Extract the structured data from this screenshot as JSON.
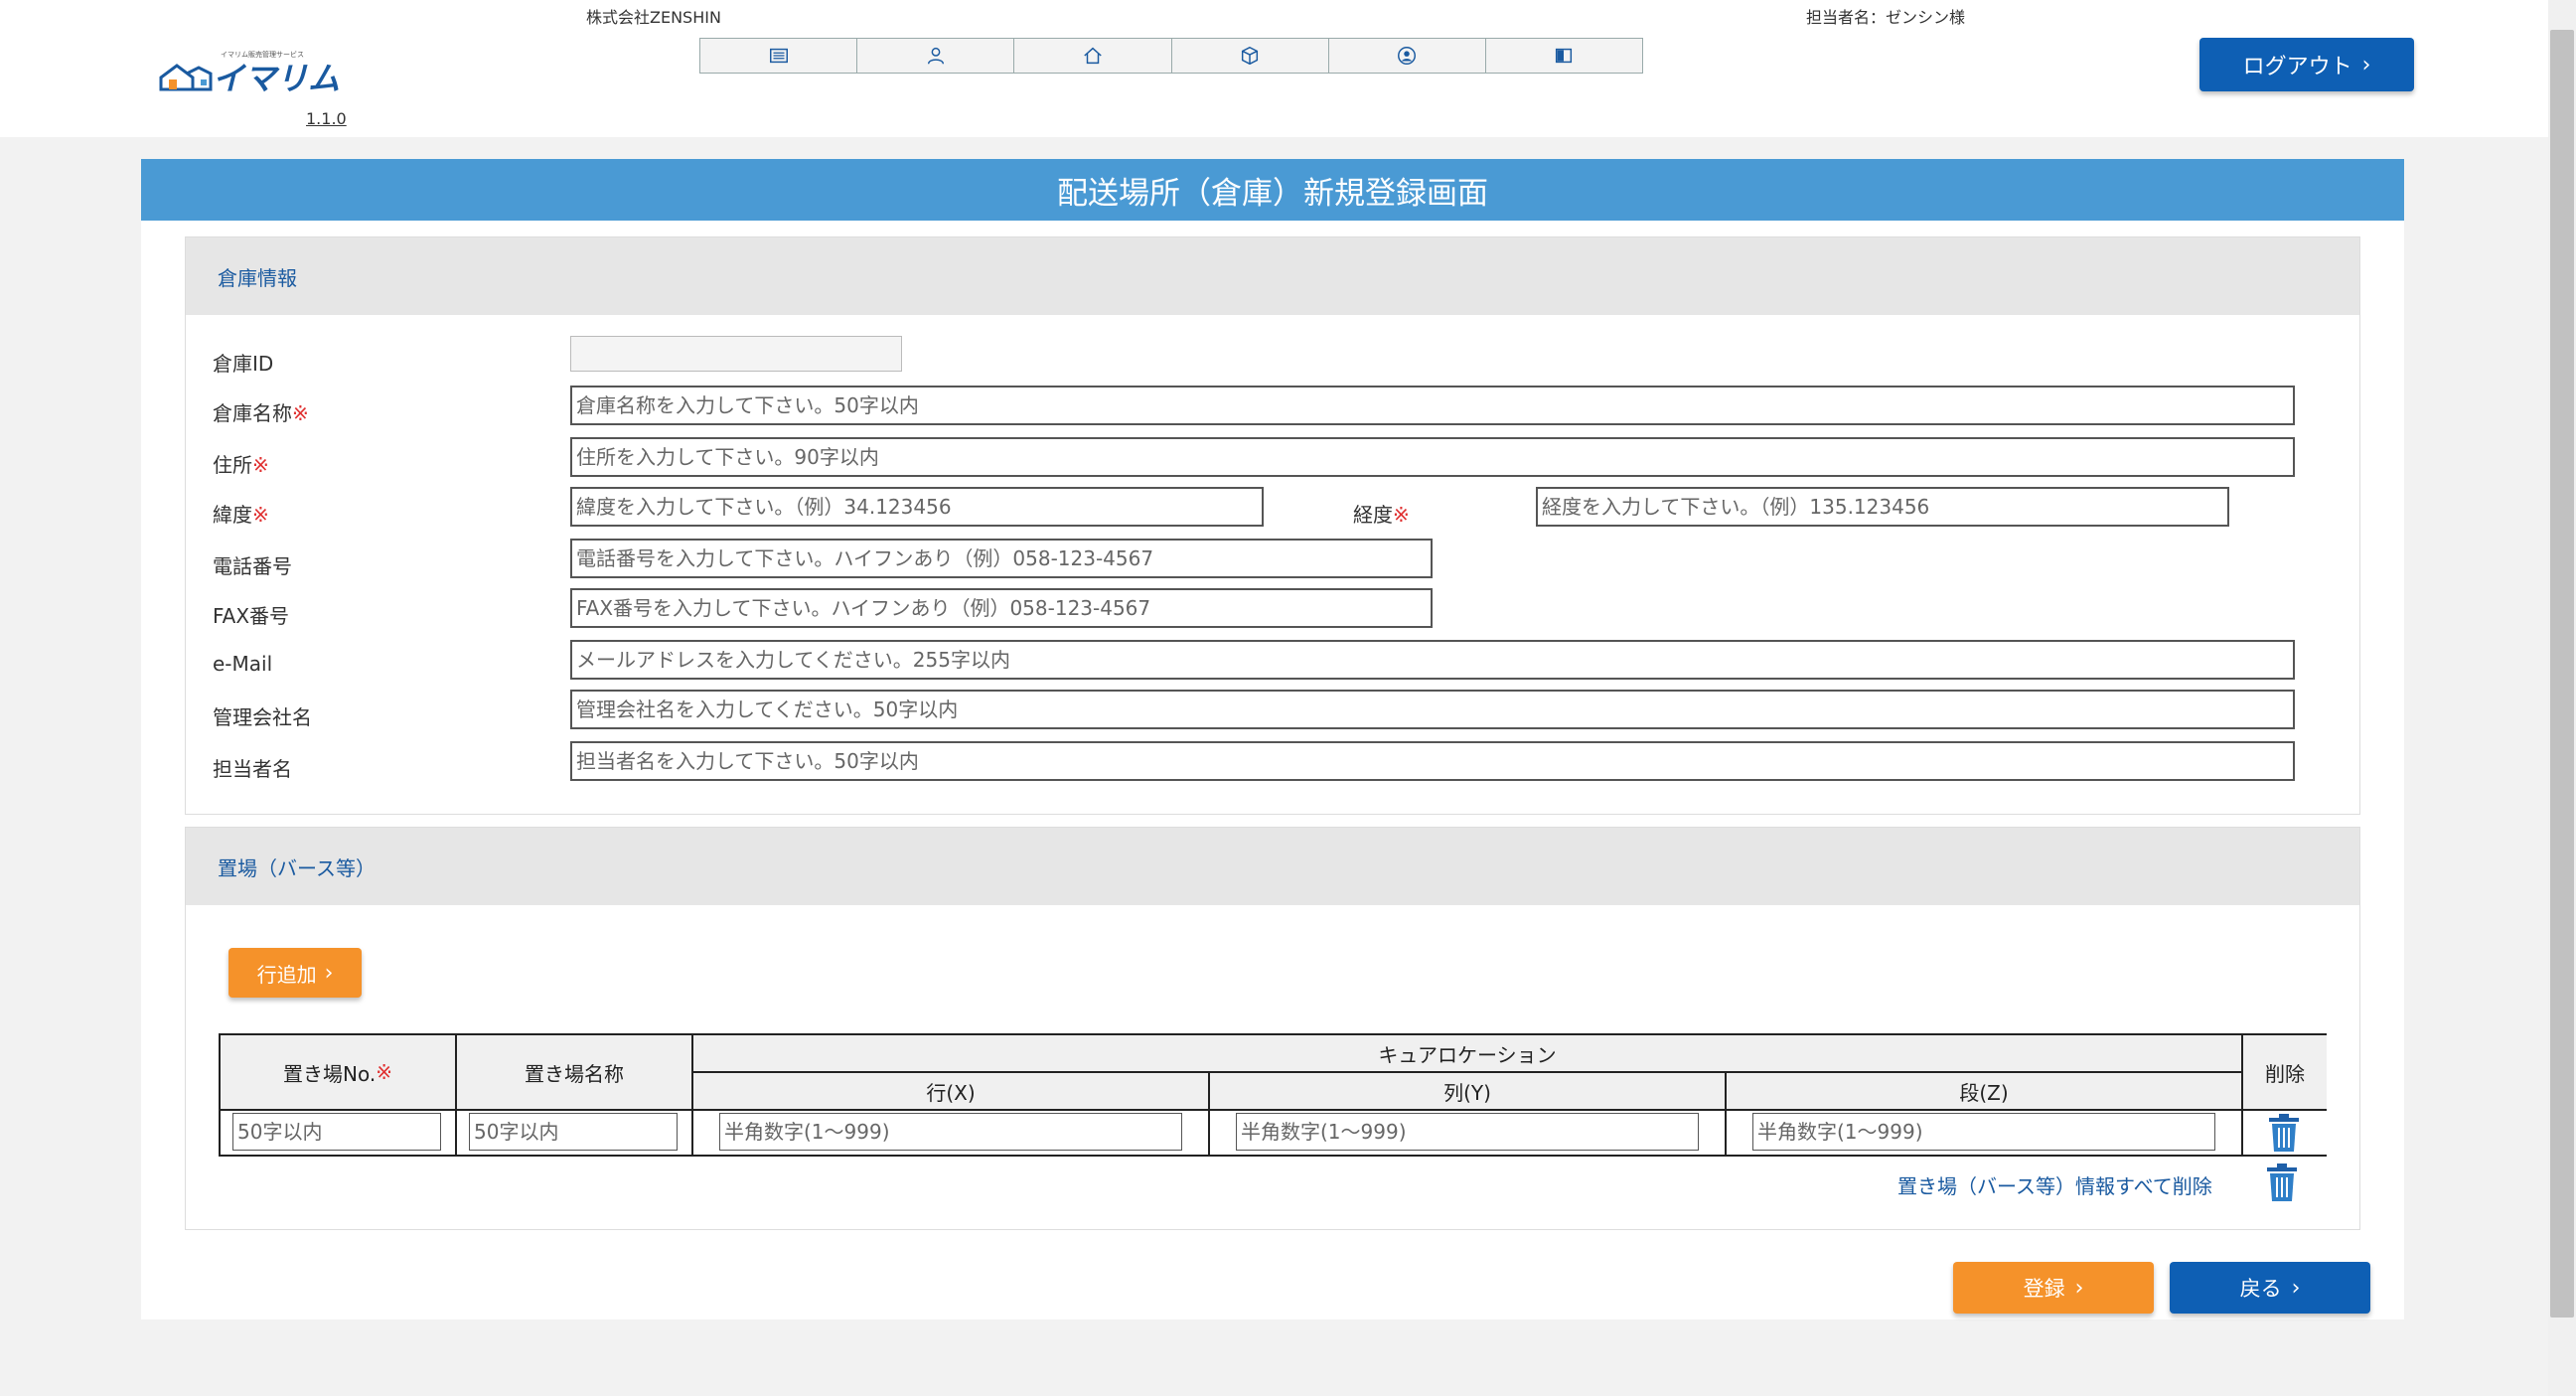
{
  "header": {
    "company": "株式会社ZENSHIN",
    "user_label": "担当者名：ゼンシン様",
    "logo_text": "イマリム",
    "logo_tagline": "イマリム販売管理サービス",
    "version": "1.1.0",
    "logout_label": "ログアウト",
    "nav_icons": [
      "list-icon",
      "user-icon",
      "home-icon",
      "box-icon",
      "account-circle-icon",
      "book-icon"
    ]
  },
  "page": {
    "title": "配送場所（倉庫）新規登録画面"
  },
  "warehouse": {
    "section_title": "倉庫情報",
    "required_mark": "※",
    "fields": {
      "id": {
        "label": "倉庫ID",
        "value": ""
      },
      "name": {
        "label": "倉庫名称",
        "placeholder": "倉庫名称を入力して下さい。50字以内"
      },
      "address": {
        "label": "住所",
        "placeholder": "住所を入力して下さい。90字以内"
      },
      "latitude": {
        "label": "緯度",
        "placeholder": "緯度を入力して下さい。（例）34.123456"
      },
      "longitude": {
        "label": "経度",
        "placeholder": "経度を入力して下さい。（例）135.123456"
      },
      "phone": {
        "label": "電話番号",
        "placeholder": "電話番号を入力して下さい。ハイフンあり（例）058-123-4567"
      },
      "fax": {
        "label": "FAX番号",
        "placeholder": "FAX番号を入力して下さい。ハイフンあり（例）058-123-4567"
      },
      "email": {
        "label": "e-Mail",
        "placeholder": "メールアドレスを入力してください。255字以内"
      },
      "company": {
        "label": "管理会社名",
        "placeholder": "管理会社名を入力してください。50字以内"
      },
      "person": {
        "label": "担当者名",
        "placeholder": "担当者名を入力して下さい。50字以内"
      }
    }
  },
  "storage": {
    "section_title": "置場（バース等）",
    "add_row_label": "行追加",
    "table": {
      "col_no": "置き場No.",
      "col_name": "置き場名称",
      "col_location": "キュアロケーション",
      "col_row": "行(X)",
      "col_col": "列(Y)",
      "col_level": "段(Z)",
      "col_delete": "削除",
      "rows": [
        {
          "no_placeholder": "50字以内",
          "name_placeholder": "50字以内",
          "row_placeholder": "半角数字(1～999)",
          "col_placeholder": "半角数字(1～999)",
          "level_placeholder": "半角数字(1～999)"
        }
      ]
    },
    "delete_all_label": "置き場（バース等）情報すべて削除"
  },
  "actions": {
    "register_label": "登録",
    "back_label": "戻る"
  },
  "colors": {
    "title_bar": "#4a9ad4",
    "primary": "#0e5fb4",
    "accent": "#f5922a",
    "required": "#e03030"
  }
}
